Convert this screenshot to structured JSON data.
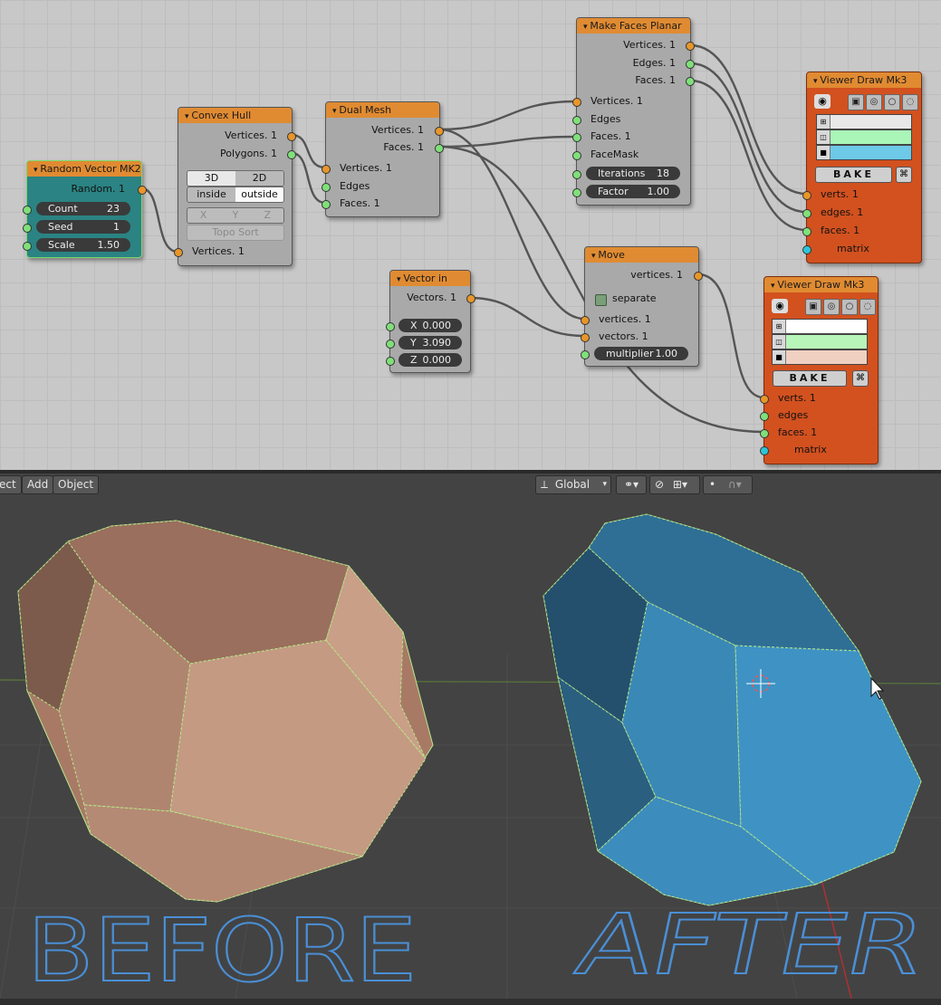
{
  "colors": {
    "editor_bg": "#c8c8c8",
    "node_header": "#e08b32",
    "viewer_node": "#d2511f",
    "random_node": "#2b8383",
    "before_mesh": "#b4826d",
    "after_mesh": "#3f92c0",
    "handwriting": "#4a8fd6",
    "wire": "#555555"
  },
  "nodes": {
    "random_vector": {
      "title": "Random Vector MK2",
      "out_random": "Random. 1",
      "count_label": "Count",
      "count_value": "23",
      "seed_label": "Seed",
      "seed_value": "1",
      "scale_label": "Scale",
      "scale_value": "1.50"
    },
    "convex_hull": {
      "title": "Convex Hull",
      "out_vertices": "Vertices. 1",
      "out_polygons": "Polygons. 1",
      "mode_3d": "3D",
      "mode_2d": "2D",
      "side_inside": "inside",
      "side_outside": "outside",
      "axis_x": "X",
      "axis_y": "Y",
      "axis_z": "Z",
      "topo_sort": "Topo Sort",
      "in_vertices": "Vertices. 1"
    },
    "dual_mesh": {
      "title": "Dual Mesh",
      "out_vertices": "Vertices. 1",
      "out_faces": "Faces. 1",
      "in_vertices": "Vertices. 1",
      "in_edges": "Edges",
      "in_faces": "Faces. 1"
    },
    "make_faces_planar": {
      "title": "Make Faces Planar",
      "out_vertices": "Vertices. 1",
      "out_edges": "Edges. 1",
      "out_faces": "Faces. 1",
      "in_vertices": "Vertices. 1",
      "in_edges": "Edges",
      "in_faces": "Faces. 1",
      "in_facemask": "FaceMask",
      "iterations_label": "Iterations",
      "iterations_value": "18",
      "factor_label": "Factor",
      "factor_value": "1.00"
    },
    "vector_in": {
      "title": "Vector in",
      "out_vectors": "Vectors. 1",
      "x_label": "X",
      "x_value": "0.000",
      "y_label": "Y",
      "y_value": "3.090",
      "z_label": "Z",
      "z_value": "0.000"
    },
    "move": {
      "title": "Move",
      "out_vertices": "vertices. 1",
      "separate_label": "separate",
      "in_vertices": "vertices. 1",
      "in_vectors": "vectors. 1",
      "multiplier_label": "multiplier",
      "multiplier_value": "1.00"
    },
    "viewer_draw_1": {
      "title": "Viewer Draw Mk3",
      "bake_label": "BAKE",
      "in_verts": "verts. 1",
      "in_edges": "edges. 1",
      "in_faces": "faces. 1",
      "in_matrix": "matrix",
      "vert_color": "#e8e8e8",
      "edge_color": "#aaf5b8",
      "face_color": "#6ec8e8"
    },
    "viewer_draw_2": {
      "title": "Viewer Draw Mk3",
      "bake_label": "BAKE",
      "in_verts": "verts. 1",
      "in_edges": "edges",
      "in_faces": "faces. 1",
      "in_matrix": "matrix",
      "vert_color": "#ffffff",
      "edge_color": "#b8f5b8",
      "face_color": "#f0d0c0"
    }
  },
  "viewport": {
    "menu_select": "ect",
    "menu_add": "Add",
    "menu_object": "Object",
    "orientation": "Global",
    "label_before": "BEFORE",
    "label_after": "AFTER"
  }
}
